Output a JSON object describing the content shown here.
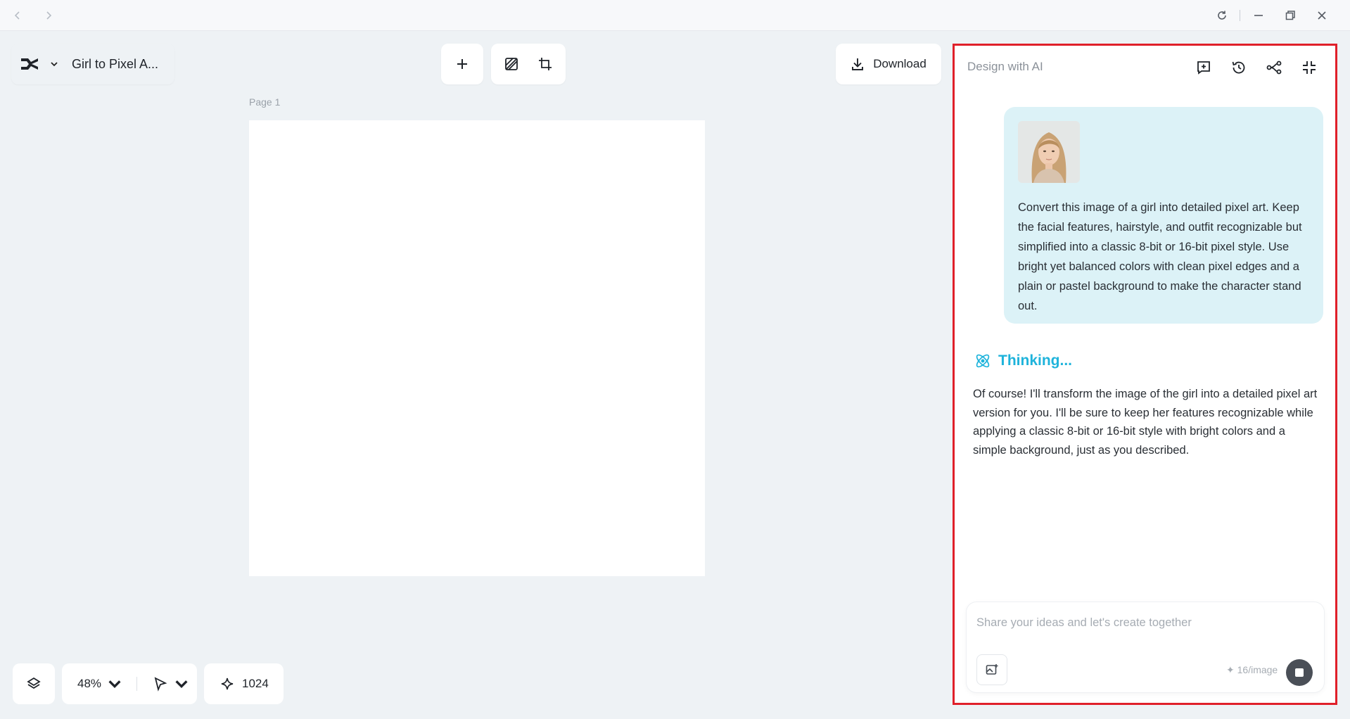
{
  "window": {
    "back_icon": "chevron-left-icon",
    "forward_icon": "chevron-right-icon",
    "controls": [
      "refresh-icon",
      "minimize-icon",
      "restore-icon",
      "close-icon"
    ]
  },
  "project": {
    "title": "Girl to Pixel A..."
  },
  "toolbar": {
    "download_label": "Download"
  },
  "canvas": {
    "page_label": "Page 1"
  },
  "bottom_bar": {
    "zoom": "48%",
    "credits": "1024"
  },
  "ai_panel": {
    "title": "Design with AI",
    "header_icons": [
      "new-chat-icon",
      "history-icon",
      "share-icon",
      "collapse-icon"
    ],
    "user_message": "Convert this image of a girl into detailed pixel art. Keep the facial features, hairstyle, and outfit recognizable but simplified into a classic 8-bit or 16-bit pixel style. Use bright yet balanced colors with clean pixel edges and a plain or pastel background to make the character stand out.",
    "thinking_label": "Thinking...",
    "ai_reply": "Of course! I'll transform the image of the girl into a detailed pixel art version for you. I'll be sure to keep her features recognizable while applying a classic 8-bit or 16-bit style with bright colors and a simple background, just as you described.",
    "input_placeholder": "Share your ideas and let's create together",
    "cost_label": "✦ 16/image"
  },
  "colors": {
    "accent_thinking": "#1eb3db",
    "highlight_border": "#e0202a",
    "user_bubble": "#dcf2f7",
    "canvas_bg": "#eef2f5"
  }
}
